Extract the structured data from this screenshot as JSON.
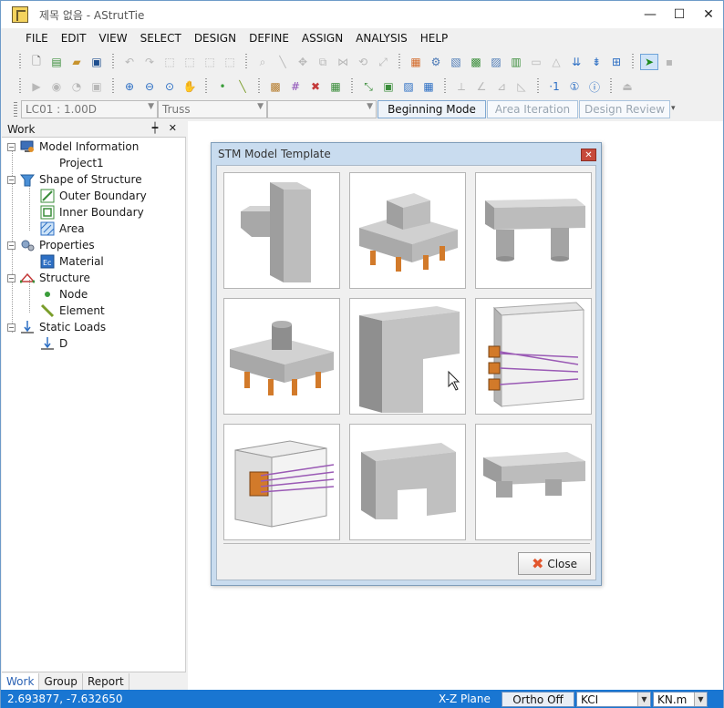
{
  "window": {
    "title": "제목 없음 - AStrutTie",
    "controls": [
      "—",
      "☐",
      "✕"
    ]
  },
  "menu": [
    "FILE",
    "EDIT",
    "VIEW",
    "SELECT",
    "DESIGN",
    "DEFINE",
    "ASSIGN",
    "ANALYSIS",
    "HELP"
  ],
  "combo": {
    "load_case": "LC01 : 1.00D",
    "model_type": "Truss",
    "third": ""
  },
  "modes": {
    "beginning": "Beginning Mode",
    "iteration": "Area Iteration",
    "review": "Design Review"
  },
  "panel": {
    "title": "Work",
    "pin": "ᵖ",
    "close": "✕",
    "tree": [
      {
        "label": "Model Information",
        "icon": "monitor-icon"
      },
      {
        "label": "Project1",
        "icon": ""
      },
      {
        "label": "Shape of Structure",
        "icon": "shape-icon"
      },
      {
        "label": "Outer Boundary",
        "icon": "outer-boundary-icon"
      },
      {
        "label": "Inner Boundary",
        "icon": "inner-boundary-icon"
      },
      {
        "label": "Area",
        "icon": "area-icon"
      },
      {
        "label": "Properties",
        "icon": "gears-icon"
      },
      {
        "label": "Material",
        "icon": "material-icon"
      },
      {
        "label": "Structure",
        "icon": "truss-icon"
      },
      {
        "label": "Node",
        "icon": "node-icon"
      },
      {
        "label": "Element",
        "icon": "element-icon"
      },
      {
        "label": "Static Loads",
        "icon": "load-icon"
      },
      {
        "label": "D",
        "icon": "load-icon"
      }
    ],
    "tabs": [
      "Work",
      "Group",
      "Report"
    ]
  },
  "dialog": {
    "title": "STM Model Template",
    "close_label": "Close",
    "templates": [
      "corbel-template",
      "pile-cap-stepped-template",
      "bridge-pier-cap-template",
      "pile-cap-column-template",
      "l-joint-template",
      "anchorage-zone-template",
      "anchor-block-template",
      "deep-beam-opening-template",
      "twin-pier-cap-template"
    ]
  },
  "status": {
    "coords": "2.693877, -7.632650",
    "plane": "X-Z Plane",
    "ortho": "Ortho Off",
    "code": "KCI",
    "units": "KN.m"
  },
  "colors": {
    "status_bar": "#1976d2",
    "dialog_frame": "#c9dcef",
    "concrete": "#bdbdbd",
    "pile": "#d27a2a"
  }
}
